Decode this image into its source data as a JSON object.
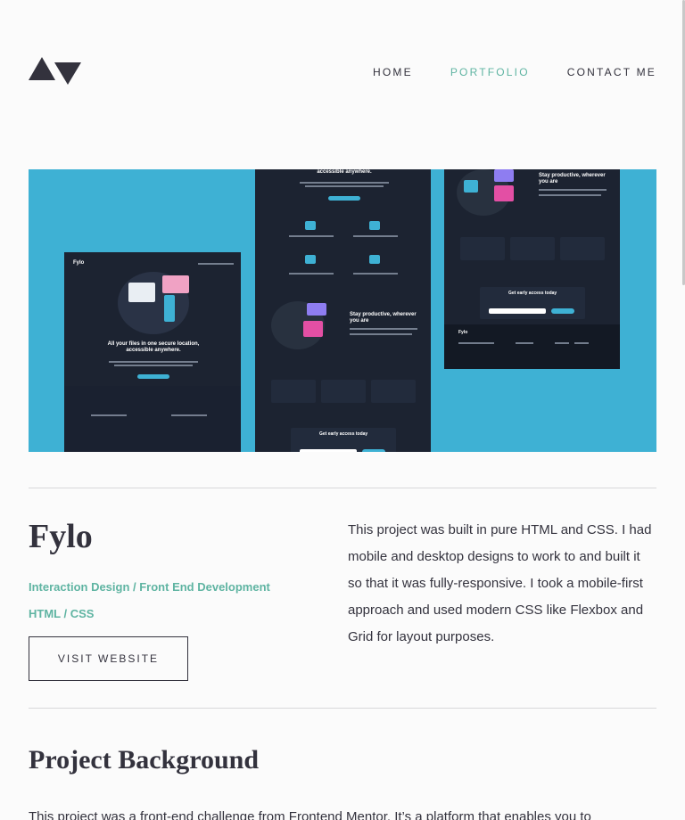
{
  "nav": {
    "items": [
      {
        "label": "HOME",
        "active": false
      },
      {
        "label": "PORTFOLIO",
        "active": true
      },
      {
        "label": "CONTACT ME",
        "active": false
      }
    ]
  },
  "hero": {
    "image_bg": "#3eb1d4",
    "mockup_texts": {
      "fylo_logo": "Fylo",
      "headline": "All your files in one secure location, accessible anywhere.",
      "headline_top": "accessible anywhere.",
      "productive": "Stay productive, wherever you are",
      "early_access": "Get early access today"
    }
  },
  "project": {
    "title": "Fylo",
    "tags_line1": "Interaction Design / Front End Development",
    "tags_line2": "HTML / CSS",
    "visit_label": "VISIT WEBSITE",
    "description": "This project was built in pure HTML and CSS. I had mobile and desktop designs to work to and built it so that it was fully-responsive. I took a mobile-first approach and used modern CSS like Flexbox and Grid for layout purposes."
  },
  "background": {
    "heading": "Project Background",
    "text": "This project was a front-end challenge from Frontend Mentor. It’s a platform that enables you to"
  },
  "colors": {
    "accent": "#5fb4a2",
    "text": "#33323d",
    "page_bg": "#fbfbfb"
  }
}
